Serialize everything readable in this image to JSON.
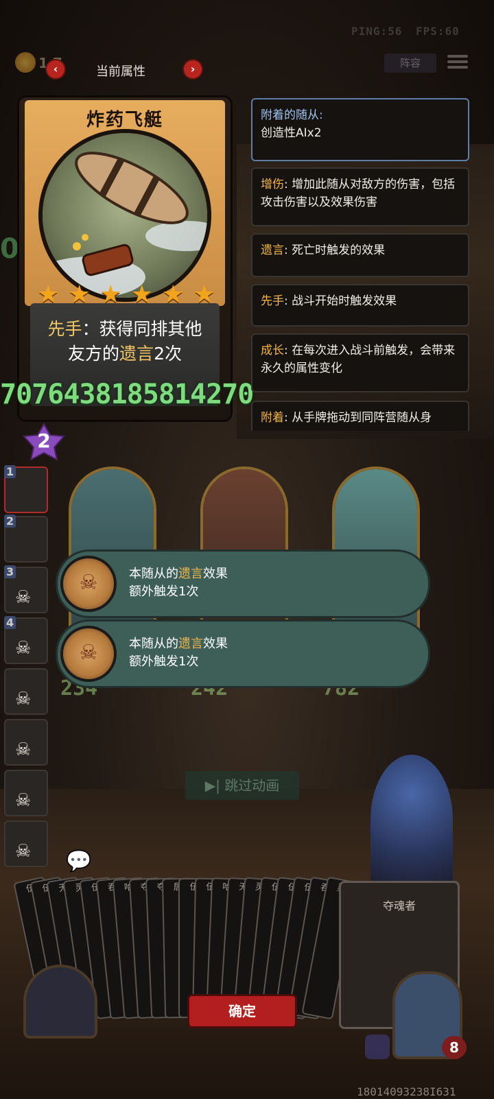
{
  "status": {
    "ping_label": "PING:56",
    "fps_label": "FPS:60"
  },
  "header": {
    "gold": "1 7",
    "title": "当前属性",
    "prev": "‹",
    "next": "›",
    "lineup": "阵容"
  },
  "card": {
    "name": "炸药飞艇",
    "stars": 6,
    "desc_key": "先手",
    "desc_rest1": "：获得同排其他",
    "desc_line2_a": "友方的",
    "desc_line2_key": "遗言",
    "desc_line2_b": "2次"
  },
  "big_number": "7076438185814270",
  "keywords": [
    {
      "key": "附着的随从:",
      "text": "创造性AIx2"
    },
    {
      "key": "增伤",
      "text": ": 增加此随从对敌方的伤害，包括攻击伤害以及效果伤害"
    },
    {
      "key": "遗言",
      "text": ": 死亡时触发的效果"
    },
    {
      "key": "先手",
      "text": ": 战斗开始时触发效果"
    },
    {
      "key": "成长",
      "text": ": 在每次进入战斗前触发，会带来永久的属性变化"
    },
    {
      "key": "附着",
      "text": ": 从手牌拖动到同阵营随从身"
    }
  ],
  "hero_level": "2",
  "slots": [
    "1",
    "2",
    "3",
    "4",
    "",
    "",
    "",
    ""
  ],
  "minion_stats": [
    "234",
    "242",
    "782"
  ],
  "toasts": [
    {
      "pre": "本随从的",
      "key": "遗言",
      "post": "效果",
      "line2": "额外触发1次"
    },
    {
      "pre": "本随从的",
      "key": "遗言",
      "post": "效果",
      "line2": "额外触发1次"
    }
  ],
  "skip": "▶| 跳过动画",
  "hand_letters": [
    "伍",
    "伍",
    "无",
    "灵",
    "伍",
    "吞",
    "哈",
    "夺",
    "夺",
    "居",
    "伍",
    "伍",
    "哈",
    "无",
    "灵",
    "伍",
    "伍",
    "伍",
    "吞",
    "灵"
  ],
  "big_hand_card": "夺魂者",
  "confirm": "确定",
  "health": "8",
  "bottom_number": "18014093238I631"
}
